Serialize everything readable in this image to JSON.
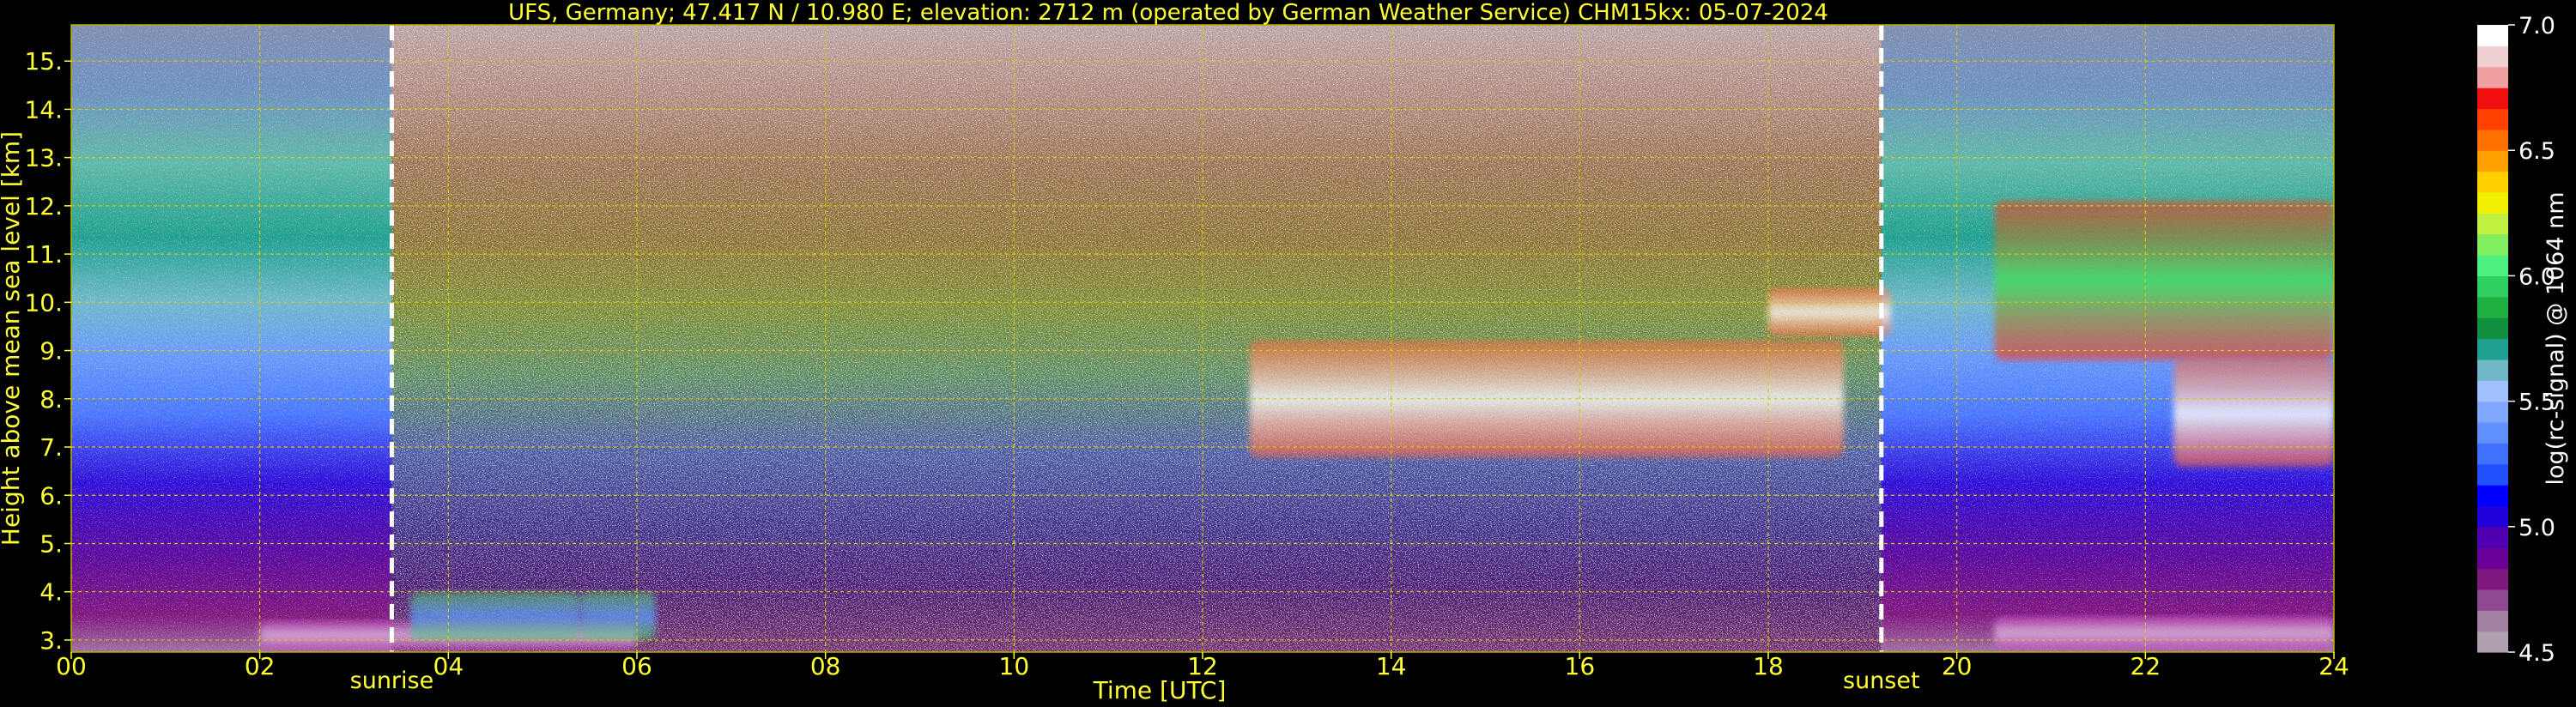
{
  "chart_data": {
    "type": "heatmap",
    "title": "UFS, Germany; 47.417 N / 10.980 E; elevation: 2712 m  (operated by German Weather Service)    CHM15kx: 05-07-2024",
    "xlabel": "Time [UTC]",
    "ylabel": "Height above mean sea level [km]",
    "x_unit": "hour UTC",
    "y_unit": "km",
    "xlim": [
      0,
      24
    ],
    "ylim": [
      2.75,
      15.75
    ],
    "x_ticks": [
      0,
      2,
      4,
      6,
      8,
      10,
      12,
      14,
      16,
      18,
      20,
      22,
      24
    ],
    "x_tick_labels": [
      "00",
      "02",
      "04",
      "06",
      "08",
      "10",
      "12",
      "14",
      "16",
      "18",
      "20",
      "22",
      "24"
    ],
    "y_ticks": [
      3,
      4,
      5,
      6,
      7,
      8,
      9,
      10,
      11,
      12,
      13,
      14,
      15
    ],
    "y_tick_labels": [
      "3.",
      "4.",
      "5.",
      "6.",
      "7.",
      "8.",
      "9.",
      "10.",
      "11.",
      "12.",
      "13.",
      "14.",
      "15."
    ],
    "grid": true,
    "events": [
      {
        "label": "sunrise",
        "time": 3.4
      },
      {
        "label": "sunset",
        "time": 19.2
      }
    ],
    "colorbar": {
      "label": "log(rc-signal) @ 1064 nm",
      "range": [
        4.5,
        7.0
      ],
      "tick_values": [
        4.5,
        5.0,
        5.5,
        6.0,
        6.5,
        7.0
      ],
      "tick_labels": [
        "4.5",
        "5.0",
        "5.5",
        "6.0",
        "6.5",
        "7.0"
      ],
      "colors": [
        "#b0a0b0",
        "#a080a0",
        "#904890",
        "#801880",
        "#6a0098",
        "#5000b0",
        "#2000d8",
        "#0000ff",
        "#2050ff",
        "#4070ff",
        "#6090ff",
        "#80a8ff",
        "#a0c0ff",
        "#70b8c8",
        "#20a090",
        "#109040",
        "#20b040",
        "#30d060",
        "#50f080",
        "#80f060",
        "#c0f040",
        "#f0f000",
        "#ffd000",
        "#ffa000",
        "#ff7000",
        "#ff4000",
        "#f01010",
        "#f0a0a0",
        "#f0d0d0",
        "#ffffff"
      ]
    },
    "background_regimes": [
      {
        "from": 0.0,
        "to": 3.4,
        "description": "night"
      },
      {
        "from": 3.4,
        "to": 19.2,
        "description": "day"
      },
      {
        "from": 19.2,
        "to": 24.0,
        "description": "night"
      }
    ],
    "features": [
      {
        "kind": "boundary_layer_aerosol",
        "start": 2.0,
        "end": 6.0,
        "bottom": 2.8,
        "top": 3.4
      },
      {
        "kind": "aerosol_plume",
        "start": 3.6,
        "end": 5.4,
        "bottom": 3.0,
        "top": 4.0
      },
      {
        "kind": "aerosol_plume",
        "start": 5.4,
        "end": 6.2,
        "bottom": 3.0,
        "top": 4.0
      },
      {
        "kind": "cloud",
        "start": 12.5,
        "end": 18.8,
        "bottom": 6.8,
        "top": 9.2
      },
      {
        "kind": "cloud",
        "start": 18.0,
        "end": 19.3,
        "bottom": 9.3,
        "top": 10.3
      },
      {
        "kind": "cirrus",
        "start": 20.4,
        "end": 24.0,
        "bottom": 8.8,
        "top": 12.1
      },
      {
        "kind": "cloud",
        "start": 22.3,
        "end": 24.0,
        "bottom": 6.6,
        "top": 8.8
      },
      {
        "kind": "boundary_layer_aerosol",
        "start": 20.4,
        "end": 24.0,
        "bottom": 2.8,
        "top": 3.5
      }
    ]
  }
}
